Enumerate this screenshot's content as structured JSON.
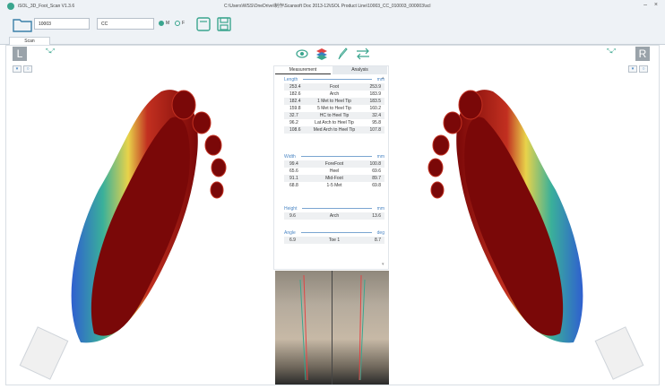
{
  "window": {
    "title": "iSOL_3D_Foot_Scan V1.3.6",
    "path": "C:\\Users\\WSS\\OneDrive\\制作\\Scansoft Doc 2013-12\\iSOL Product Line\\10003_CC_010003_000003\\scl"
  },
  "toolbar": {
    "patient_id": "10003",
    "name": "CC",
    "gender_m": "M",
    "gender_f": "F"
  },
  "tabs": [
    "Scan"
  ],
  "left_view_label": "L",
  "right_view_label": "R",
  "panel": {
    "tabs": [
      "Measurement",
      "Analysis"
    ],
    "length": {
      "title": "Length",
      "unit": "mm",
      "rows": [
        {
          "l": "253.4",
          "m": "Foot",
          "r": "253.9"
        },
        {
          "l": "182.6",
          "m": "Arch",
          "r": "183.9"
        },
        {
          "l": "182.4",
          "m": "1 Met to Heel Tip",
          "r": "183.5"
        },
        {
          "l": "159.8",
          "m": "5 Met to Heel Tip",
          "r": "160.2"
        },
        {
          "l": "32.7",
          "m": "HC to Heel Tip",
          "r": "32.4"
        },
        {
          "l": "96.2",
          "m": "Lat Arch to Heel Tip",
          "r": "95.8"
        },
        {
          "l": "108.6",
          "m": "Med Arch to Heel Tip",
          "r": "107.8"
        }
      ]
    },
    "width": {
      "title": "Width",
      "unit": "mm",
      "rows": [
        {
          "l": "99.4",
          "m": "ForeFoot",
          "r": "100.8"
        },
        {
          "l": "65.6",
          "m": "Heel",
          "r": "69.6"
        },
        {
          "l": "91.1",
          "m": "Mid-Foot",
          "r": "89.7"
        },
        {
          "l": "68.8",
          "m": "1-5 Met",
          "r": "69.8"
        }
      ]
    },
    "height": {
      "title": "Height",
      "unit": "mm",
      "rows": [
        {
          "l": "9.6",
          "m": "Arch",
          "r": "13.6"
        }
      ]
    },
    "angle": {
      "title": "Angle",
      "unit": "deg",
      "rows": [
        {
          "l": "6.9",
          "m": "Toe 1",
          "r": "8.7"
        }
      ]
    }
  },
  "icons": {
    "accent": "#3aa58e",
    "blue": "#4b86c4"
  }
}
